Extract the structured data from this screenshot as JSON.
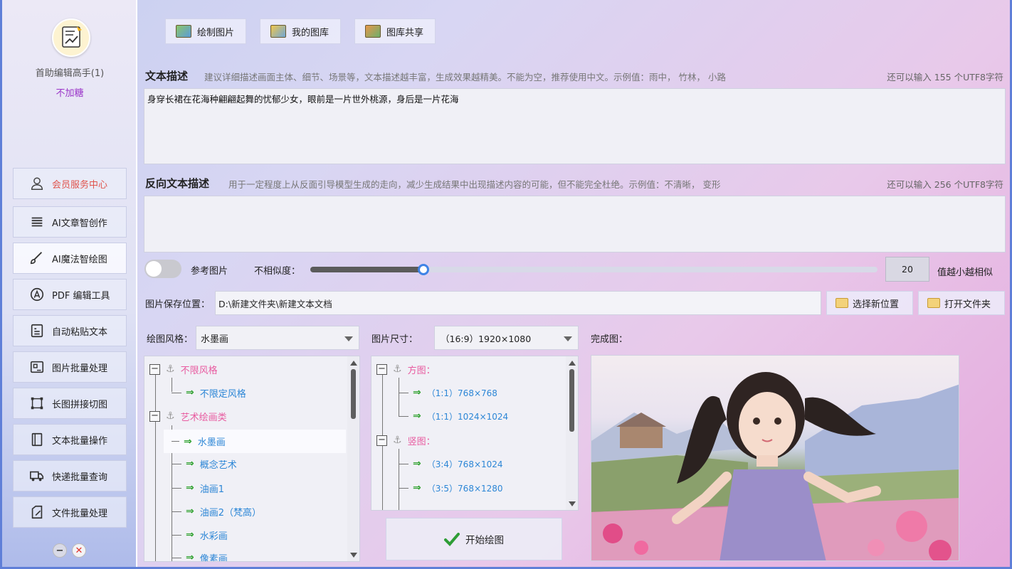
{
  "sidebar": {
    "app_name": "首助编辑高手(1)",
    "vip_status": "不加糖",
    "nav": [
      {
        "label": "会员服务中心",
        "icon": "user-icon"
      },
      {
        "label": "AI文章智创作",
        "icon": "list-icon"
      },
      {
        "label": "AI魔法智绘图",
        "icon": "brush-icon"
      },
      {
        "label": "PDF 编辑工具",
        "icon": "pdf-icon"
      },
      {
        "label": "自动粘贴文本",
        "icon": "paste-icon"
      },
      {
        "label": "图片批量处理",
        "icon": "image-icon"
      },
      {
        "label": "长图拼接切图",
        "icon": "crop-icon"
      },
      {
        "label": "文本批量操作",
        "icon": "text-icon"
      },
      {
        "label": "快递批量查询",
        "icon": "truck-icon"
      },
      {
        "label": "文件批量处理",
        "icon": "file-edit-icon"
      }
    ],
    "minimize": "−",
    "close": "✕"
  },
  "tabs": [
    {
      "label": "绘制图片",
      "icon": "draw-image-icon"
    },
    {
      "label": "我的图库",
      "icon": "gallery-icon"
    },
    {
      "label": "图库共享",
      "icon": "share-gallery-icon"
    }
  ],
  "prompt": {
    "title": "文本描述",
    "hint": "建议详细描述画面主体、细节、场景等，文本描述越丰富，生成效果越精美。不能为空，推荐使用中文。示例值：雨中，  竹林，  小路",
    "remaining": "还可以输入 155 个UTF8字符",
    "value": "身穿长裙在花海种翩翩起舞的忧郁少女，眼前是一片世外桃源，身后是一片花海"
  },
  "negative": {
    "title": "反向文本描述",
    "hint": "用于一定程度上从反面引导模型生成的走向，减少生成结果中出现描述内容的可能，但不能完全杜绝。示例值：不清晰，  变形",
    "remaining": "还可以输入 256 个UTF8字符",
    "value": ""
  },
  "reference": {
    "label": "参考图片",
    "enabled": false,
    "dissimilarity_label": "不相似度：",
    "value": "20",
    "value_fraction": 0.2,
    "note": "值越小越相似"
  },
  "save": {
    "label": "图片保存位置：",
    "path": "D:\\新建文件夹\\新建文本文档",
    "choose_btn": "选择新位置",
    "open_btn": "打开文件夹"
  },
  "style": {
    "label": "绘图风格：",
    "selected": "水墨画",
    "tree": [
      {
        "kind": "cat",
        "label": "不限风格"
      },
      {
        "kind": "leaf",
        "label": "不限定风格"
      },
      {
        "kind": "cat",
        "label": "艺术绘画类"
      },
      {
        "kind": "leaf",
        "label": "水墨画",
        "selected": true
      },
      {
        "kind": "leaf",
        "label": "概念艺术"
      },
      {
        "kind": "leaf",
        "label": "油画1"
      },
      {
        "kind": "leaf",
        "label": "油画2（梵高）"
      },
      {
        "kind": "leaf",
        "label": "水彩画"
      },
      {
        "kind": "leaf",
        "label": "像素画"
      }
    ]
  },
  "size": {
    "label": "图片尺寸：",
    "selected": "（16:9）1920×1080",
    "tree": [
      {
        "kind": "cat",
        "label": "方图："
      },
      {
        "kind": "leaf",
        "label": "（1:1）768×768"
      },
      {
        "kind": "leaf",
        "label": "（1:1）1024×1024"
      },
      {
        "kind": "cat",
        "label": "竖图："
      },
      {
        "kind": "leaf",
        "label": "（3:4）768×1024"
      },
      {
        "kind": "leaf",
        "label": "（3:5）768×1280"
      }
    ]
  },
  "start_btn": "开始绘图",
  "result_label": "完成图："
}
